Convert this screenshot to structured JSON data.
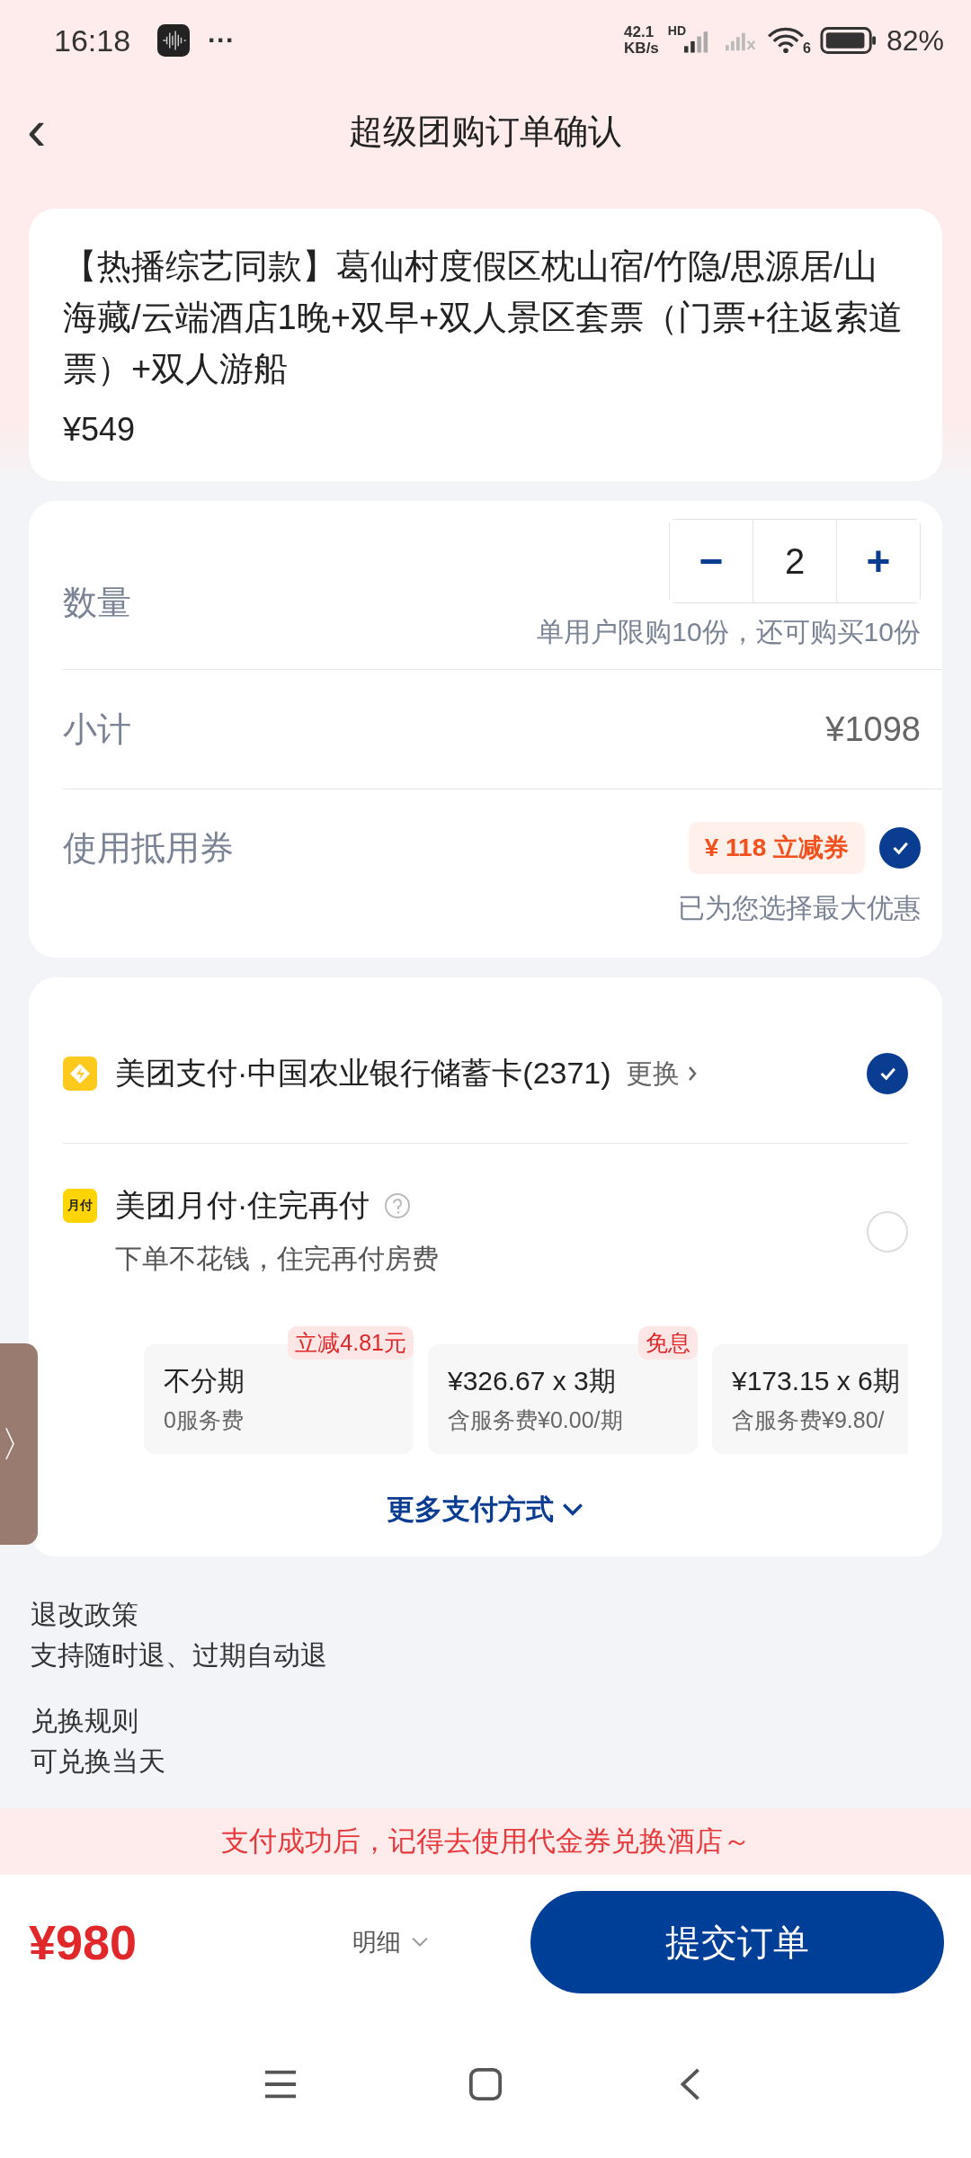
{
  "status_bar": {
    "time": "16:18",
    "more": "···",
    "speed": "42.1",
    "speed_unit": "KB/s",
    "signal_label": "HD",
    "wifi_label": "6",
    "battery": "82%"
  },
  "nav": {
    "back": "‹",
    "title": "超级团购订单确认"
  },
  "product": {
    "title": "【热播综艺同款】葛仙村度假区枕山宿/竹隐/思源居/山海藏/云端酒店1晚+双早+双人景区套票（门票+往返索道票）+双人游船",
    "price": "¥549"
  },
  "order": {
    "quantity": {
      "label": "数量",
      "minus": "−",
      "value": "2",
      "plus": "+",
      "hint": "单用户限购10份，还可购买10份"
    },
    "subtotal": {
      "label": "小计",
      "value": "¥1098"
    },
    "coupon": {
      "label": "使用抵用券",
      "tag": "¥ 118 立减券",
      "checked": true,
      "hint": "已为您选择最大优惠"
    }
  },
  "payment": {
    "methods": [
      {
        "kind": "card",
        "name": "美团支付·中国农业银行储蓄卡(2371)",
        "action": "更换",
        "selected": true
      },
      {
        "kind": "later",
        "icon_text": "月付",
        "name": "美团月付·住完再付",
        "subtitle": "下单不花钱，住完再付房费",
        "selected": false
      }
    ],
    "installments": [
      {
        "title": "不分期",
        "fee": "0服务费",
        "tag": "立减4.81元"
      },
      {
        "title": "¥326.67 x 3期",
        "fee": "含服务费¥0.00/期",
        "tag": "免息"
      },
      {
        "title": "¥173.15 x 6期",
        "fee": "含服务费¥9.80/"
      }
    ],
    "more": "更多支付方式"
  },
  "side_tab": "〉",
  "policies": [
    {
      "title": "退改政策",
      "text": "支持随时退、过期自动退"
    },
    {
      "title": "兑换规则",
      "text": "可兑换当天"
    }
  ],
  "notice": "支付成功后，记得去使用代金券兑换酒店～",
  "footer": {
    "total": "¥980",
    "detail": "明细",
    "submit": "提交订单"
  }
}
